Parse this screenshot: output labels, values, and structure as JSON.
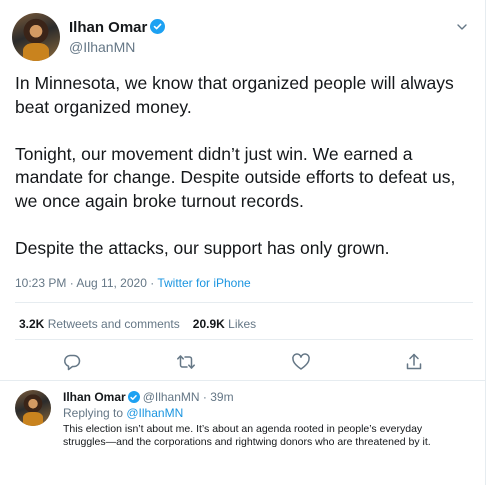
{
  "tweet": {
    "author_name": "Ilhan Omar",
    "author_handle": "@IlhanMN",
    "paragraphs": [
      "In Minnesota, we know that organized people will always beat organized money.",
      "Tonight, our movement didn’t just win. We earned a mandate for change. Despite outside efforts to defeat us, we once again broke turnout records.",
      "Despite the attacks, our support has only grown."
    ],
    "timestamp": "10:23 PM · Aug 11, 2020 · ",
    "source": "Twitter for iPhone",
    "retweets_count": "3.2K",
    "retweets_label": "Retweets and comments",
    "likes_count": "20.9K",
    "likes_label": "Likes"
  },
  "reply": {
    "author_name": "Ilhan Omar",
    "author_handle": "@IlhanMN",
    "time": " · 39m",
    "replying_label": "Replying to ",
    "replying_to": "@IlhanMN",
    "text": "This election isn’t about me. It’s about an agenda rooted in people’s everyday struggles—and the corporations and rightwing donors who are threatened by it."
  },
  "icons": {
    "verified": "verified-badge-icon",
    "menu": "chevron-down-icon",
    "actions": [
      "reply-icon",
      "retweet-icon",
      "like-icon",
      "share-icon"
    ]
  },
  "colors": {
    "accent": "#1da1f2",
    "link": "#1b95e0",
    "muted_text": "#657786",
    "text": "#14171a",
    "divider": "#e6ecf0"
  }
}
